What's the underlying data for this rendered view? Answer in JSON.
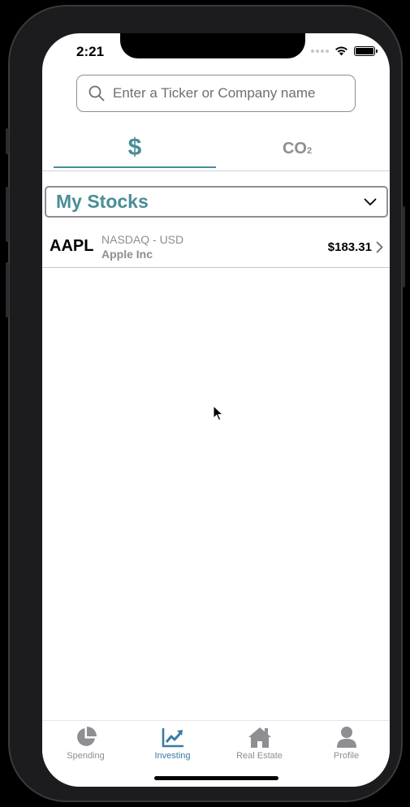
{
  "status_bar": {
    "time": "2:21"
  },
  "search": {
    "placeholder": "Enter a Ticker or Company name",
    "value": ""
  },
  "tabs": [
    {
      "label": "$",
      "active": true
    },
    {
      "label": "CO",
      "subscript": "2",
      "active": false
    }
  ],
  "dropdown": {
    "title": "My Stocks"
  },
  "stocks": [
    {
      "ticker": "AAPL",
      "exchange": "NASDAQ - USD",
      "company": "Apple Inc",
      "price": "$183.31"
    }
  ],
  "tabbar": {
    "items": [
      {
        "label": "Spending",
        "icon": "pie-chart-icon",
        "active": false
      },
      {
        "label": "Investing",
        "icon": "chart-line-icon",
        "active": true
      },
      {
        "label": "Real Estate",
        "icon": "home-icon",
        "active": false
      },
      {
        "label": "Profile",
        "icon": "user-icon",
        "active": false
      }
    ]
  },
  "colors": {
    "accent": "#4a8e96",
    "tab_active": "#3a7ca5",
    "inactive": "#8e8e93"
  }
}
